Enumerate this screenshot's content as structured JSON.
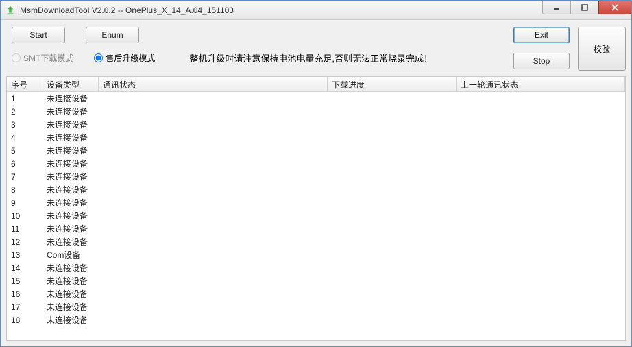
{
  "title": "MsmDownloadTool V2.0.2 -- OnePlus_X_14_A.04_151103",
  "buttons": {
    "start": "Start",
    "enum": "Enum",
    "exit": "Exit",
    "stop": "Stop",
    "verify": "校验"
  },
  "radios": {
    "smt": "SMT下载模式",
    "after_sale": "售后升级模式"
  },
  "notice": "整机升级时请注意保持电池电量充足,否则无法正常烧录完成！",
  "columns": {
    "num": "序号",
    "type": "设备类型",
    "comm": "通讯状态",
    "prog": "下载进度",
    "last": "上一轮通讯状态"
  },
  "rows": [
    {
      "num": "1",
      "type": "未连接设备",
      "comm": "",
      "prog": "",
      "last": ""
    },
    {
      "num": "2",
      "type": "未连接设备",
      "comm": "",
      "prog": "",
      "last": ""
    },
    {
      "num": "3",
      "type": "未连接设备",
      "comm": "",
      "prog": "",
      "last": ""
    },
    {
      "num": "4",
      "type": "未连接设备",
      "comm": "",
      "prog": "",
      "last": ""
    },
    {
      "num": "5",
      "type": "未连接设备",
      "comm": "",
      "prog": "",
      "last": ""
    },
    {
      "num": "6",
      "type": "未连接设备",
      "comm": "",
      "prog": "",
      "last": ""
    },
    {
      "num": "7",
      "type": "未连接设备",
      "comm": "",
      "prog": "",
      "last": ""
    },
    {
      "num": "8",
      "type": "未连接设备",
      "comm": "",
      "prog": "",
      "last": ""
    },
    {
      "num": "9",
      "type": "未连接设备",
      "comm": "",
      "prog": "",
      "last": ""
    },
    {
      "num": "10",
      "type": "未连接设备",
      "comm": "",
      "prog": "",
      "last": ""
    },
    {
      "num": "11",
      "type": "未连接设备",
      "comm": "",
      "prog": "",
      "last": ""
    },
    {
      "num": "12",
      "type": "未连接设备",
      "comm": "",
      "prog": "",
      "last": ""
    },
    {
      "num": "13",
      "type": "Com设备",
      "comm": "",
      "prog": "",
      "last": ""
    },
    {
      "num": "14",
      "type": "未连接设备",
      "comm": "",
      "prog": "",
      "last": ""
    },
    {
      "num": "15",
      "type": "未连接设备",
      "comm": "",
      "prog": "",
      "last": ""
    },
    {
      "num": "16",
      "type": "未连接设备",
      "comm": "",
      "prog": "",
      "last": ""
    },
    {
      "num": "17",
      "type": "未连接设备",
      "comm": "",
      "prog": "",
      "last": ""
    },
    {
      "num": "18",
      "type": "未连接设备",
      "comm": "",
      "prog": "",
      "last": ""
    }
  ]
}
